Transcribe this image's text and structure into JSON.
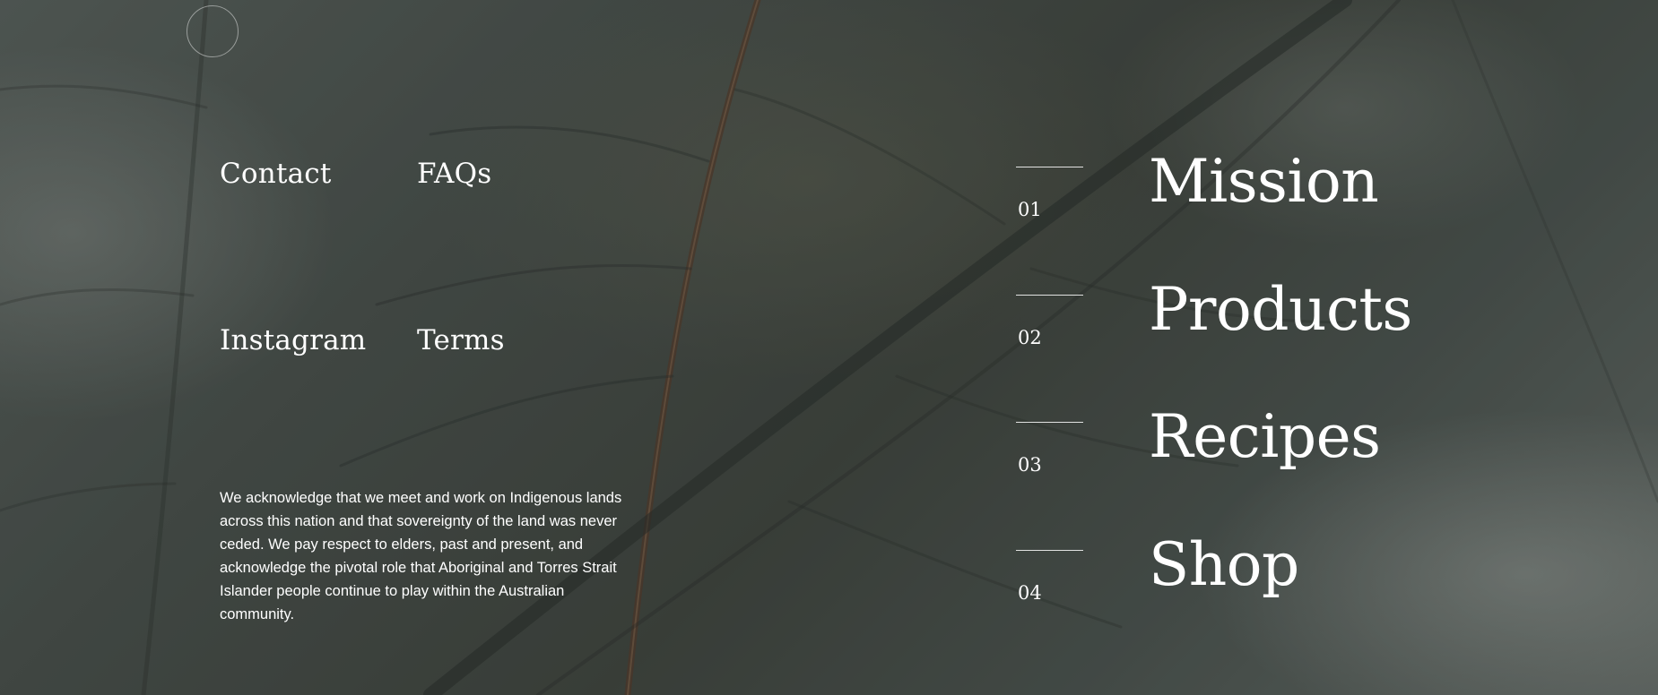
{
  "footer": {
    "links": [
      {
        "label": "Contact"
      },
      {
        "label": "FAQs"
      },
      {
        "label": "Instagram"
      },
      {
        "label": "Terms"
      }
    ],
    "acknowledgement": "We acknowledge that we meet and work on Indigenous lands across this nation and that sovereignty of the land was never ceded. We pay respect to elders, past and present, and acknowledge the pivotal role that Aboriginal and Torres Strait Islander people continue to play within the Australian community."
  },
  "nav": {
    "items": [
      {
        "number": "01",
        "label": "Mission"
      },
      {
        "number": "02",
        "label": "Products"
      },
      {
        "number": "03",
        "label": "Recipes"
      },
      {
        "number": "04",
        "label": "Shop"
      }
    ]
  },
  "colors": {
    "text": "#ffffff",
    "background": "#4a504b"
  },
  "icons": {
    "logo": "circle-logo-icon"
  }
}
